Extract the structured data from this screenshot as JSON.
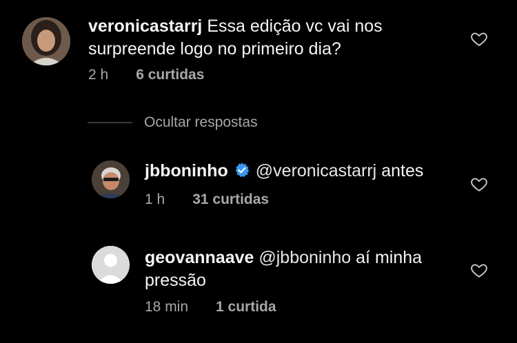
{
  "comments": [
    {
      "username": "veronicastarrj",
      "text": "Essa edição vc vai nos",
      "text_line2": "surpreende logo no primeiro dia?",
      "time": "2 h",
      "likes": "6 curtidas"
    }
  ],
  "replies_toggle": {
    "label": "Ocultar respostas"
  },
  "replies": [
    {
      "username": "jbboninho",
      "verified": true,
      "mention": "@veronicastarrj",
      "text": "antes",
      "time": "1 h",
      "likes": "31 curtidas"
    },
    {
      "username": "geovannaave",
      "mention": "@jbboninho",
      "text": "aí minha",
      "text_line2": "pressão",
      "time": "18 min",
      "likes": "1 curtida"
    }
  ],
  "colors": {
    "background": "#000000",
    "text": "#f5f5f5",
    "meta": "#a8a8a8",
    "verified": "#3897f0"
  },
  "icons": [
    "heart-outline-icon",
    "verified-badge-icon",
    "default-avatar-icon"
  ]
}
